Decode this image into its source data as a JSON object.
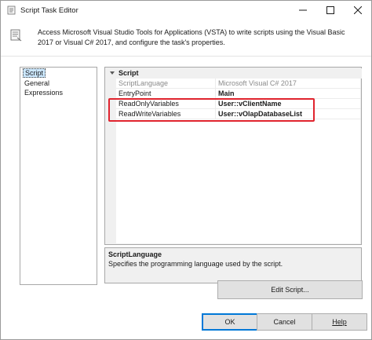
{
  "window": {
    "title": "Script Task Editor"
  },
  "header": {
    "description": "Access Microsoft Visual Studio Tools for Applications (VSTA) to write scripts using the Visual Basic 2017 or Visual C# 2017, and configure the task's properties."
  },
  "nav": {
    "items": [
      {
        "label": "Script",
        "selected": true
      },
      {
        "label": "General",
        "selected": false
      },
      {
        "label": "Expressions",
        "selected": false
      }
    ]
  },
  "grid": {
    "category": "Script",
    "properties": [
      {
        "name": "ScriptLanguage",
        "value": "Microsoft Visual C# 2017"
      },
      {
        "name": "EntryPoint",
        "value": "Main"
      },
      {
        "name": "ReadOnlyVariables",
        "value": "User::vClientName"
      },
      {
        "name": "ReadWriteVariables",
        "value": "User::vOlapDatabaseList"
      }
    ]
  },
  "description_panel": {
    "title": "ScriptLanguage",
    "text": "Specifies the programming language used by the script."
  },
  "buttons": {
    "edit_script": "Edit Script...",
    "ok": "OK",
    "cancel": "Cancel",
    "help": "Help"
  },
  "colors": {
    "highlight": "#e0242e",
    "selection": "#cce8ff",
    "default_button_border": "#0078d7"
  }
}
